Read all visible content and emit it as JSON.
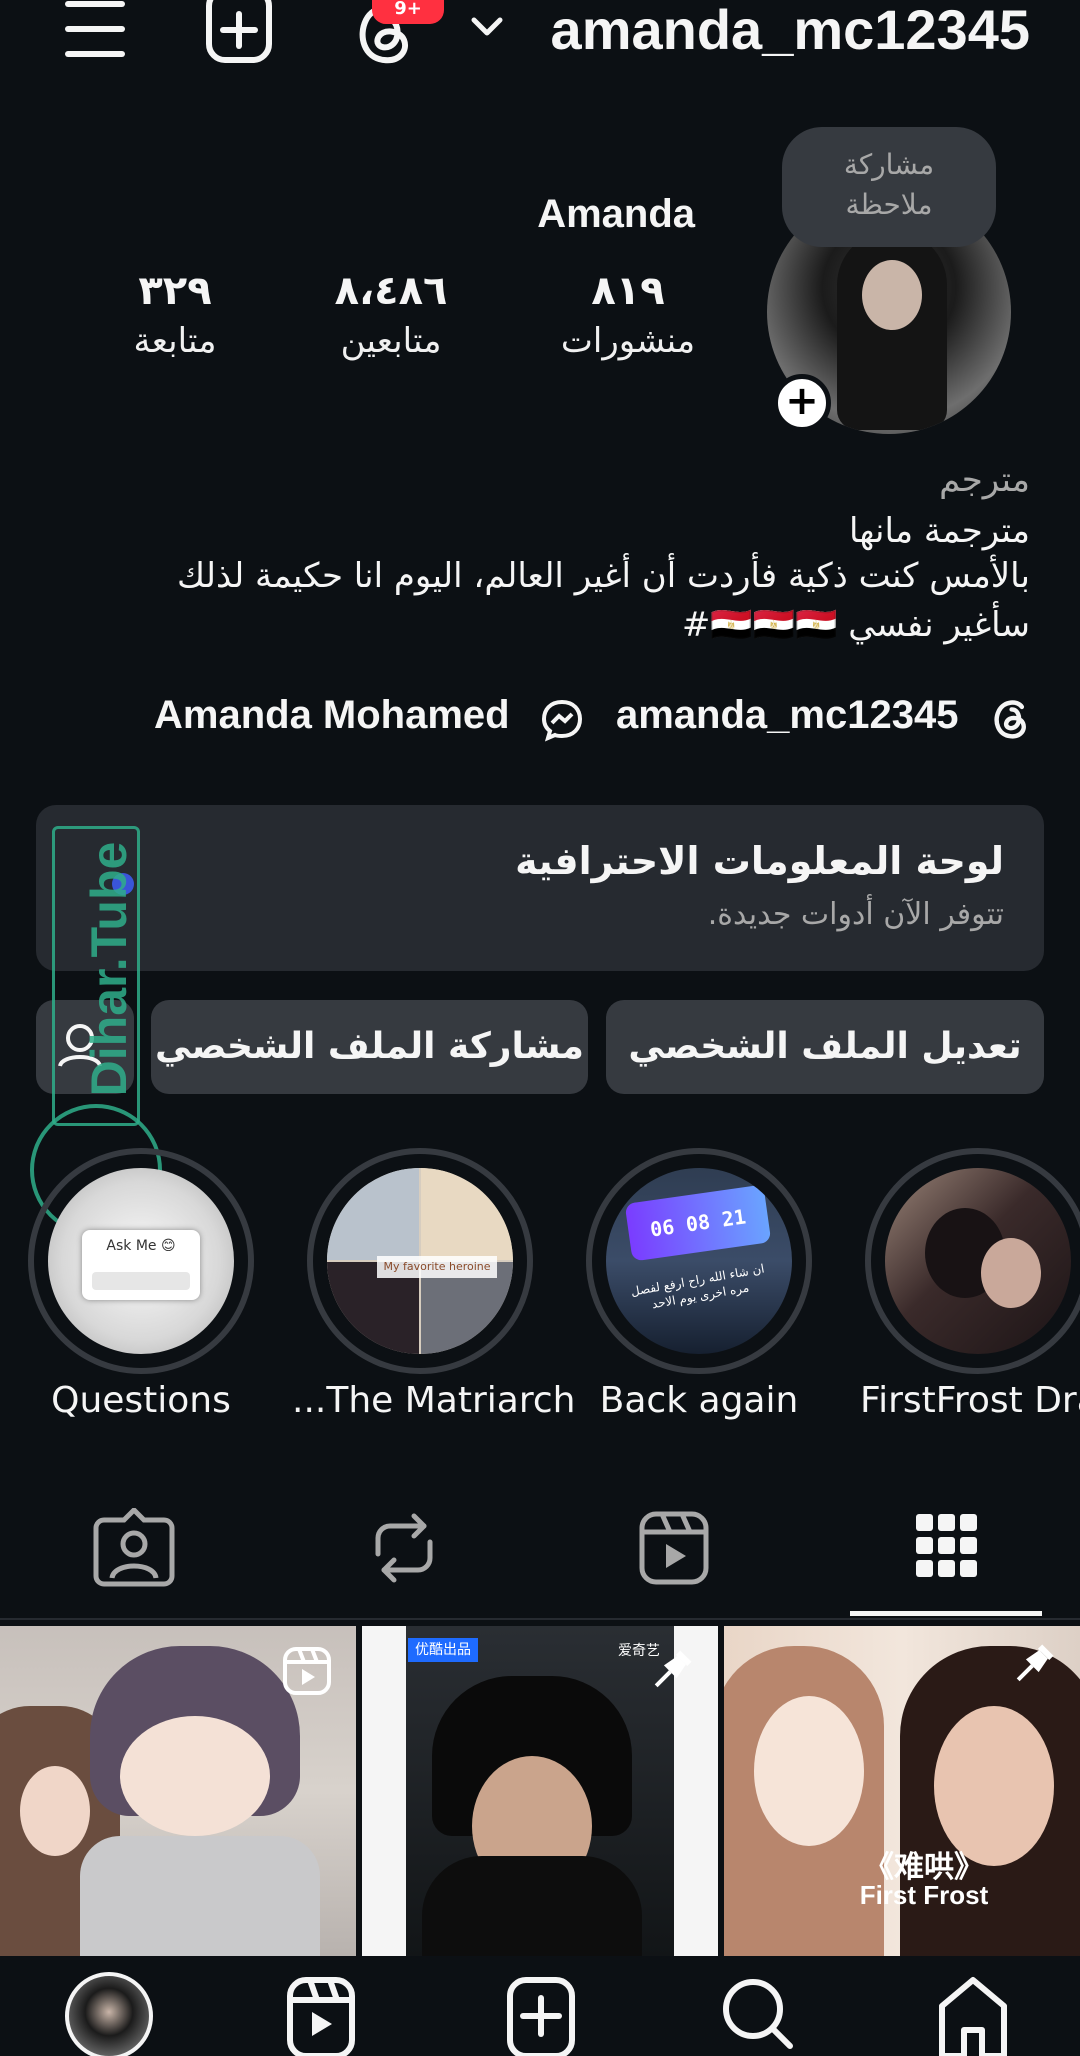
{
  "topbar": {
    "username": "amanda_mc12345",
    "notification_count": "9+"
  },
  "profile": {
    "display_name": "Amanda",
    "note_bubble": "مشاركة ملاحظة",
    "stats": [
      {
        "count": "٨١٩",
        "label": "منشورات"
      },
      {
        "count": "٨،٤٨٦",
        "label": "متابعين"
      },
      {
        "count": "٣٢٩",
        "label": "متابعة"
      }
    ],
    "category": "مترجم",
    "bio": [
      "مترجمة مانها",
      "بالأمس كنت ذكية فأردت أن أغير العالم، اليوم انا حكيمة لذلك",
      "سأغير نفسي 🇪🇬🇪🇬🇪🇬#"
    ],
    "threads_handle": "amanda_mc12345",
    "messenger_name": "Amanda Mohamed"
  },
  "dashboard": {
    "title": "لوحة المعلومات الاحترافية",
    "subtitle": "تتوفر الآن أدوات جديدة."
  },
  "buttons": {
    "edit_profile": "تعديل الملف الشخصي",
    "share_profile": "مشاركة الملف الشخصي"
  },
  "highlights": [
    {
      "label": "Questions",
      "icon": "ask-me-sticker"
    },
    {
      "label": "...The Matriarch",
      "icon": "manga-collage"
    },
    {
      "label": "Back again",
      "icon": "countdown-sticker"
    },
    {
      "label": "FirstFrost Dra",
      "icon": "drama-couple"
    }
  ],
  "highlight_texts": {
    "ask_me": "Ask Me 😊",
    "heroine": "My favorite heroine",
    "countdown": "06 08 21",
    "arabic_caption": "ان شاء الله راح ارفع لفصل مره اخرى يوم الاحد"
  },
  "tabs": [
    "tagged-icon",
    "reposts-icon",
    "reels-icon",
    "grid-icon"
  ],
  "active_tab": "grid",
  "posts": [
    {
      "type": "reel",
      "badge": "reel-icon"
    },
    {
      "type": "pinned",
      "badge": "pin-icon",
      "tag": "优酷出品",
      "tag2": "爱奇艺"
    },
    {
      "type": "pinned",
      "badge": "pin-icon",
      "caption_cn": "《难哄》",
      "caption_en": "First Frost"
    }
  ],
  "watermark": "Dihar.Tube",
  "colors": {
    "background": "#0c1014",
    "button": "#363a40",
    "card": "#262a30",
    "badge": "#ff3040",
    "watermark": "#2fae8a"
  }
}
